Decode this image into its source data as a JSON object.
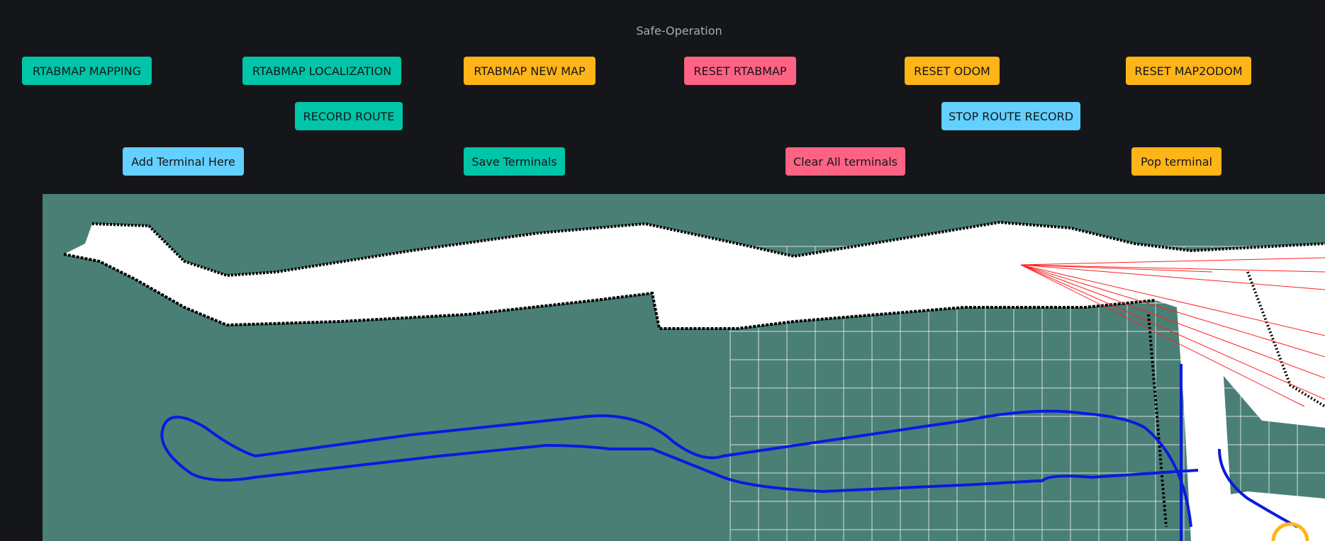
{
  "app": {
    "title": "Safe-Operation"
  },
  "controls": {
    "row1": {
      "mapping": "RTABMAP MAPPING",
      "localization": "RTABMAP LOCALIZATION",
      "new_map": "RTABMAP NEW MAP",
      "reset_rtabmap": "RESET RTABMAP",
      "reset_odom": "RESET ODOM",
      "reset_map2odom": "RESET MAP2ODOM"
    },
    "row2": {
      "record_route": "RECORD ROUTE",
      "stop_route_record": "STOP ROUTE RECORD"
    },
    "row3": {
      "add_terminal": "Add Terminal Here",
      "save_terminals": "Save Terminals",
      "clear_terminals": "Clear All terminals",
      "pop_terminal": "Pop terminal"
    }
  },
  "colors": {
    "background": "#15161a",
    "map_background": "#4a7f76",
    "teal": "#00c5a8",
    "orange": "#ffb418",
    "pink": "#ff6384",
    "blue": "#63d0ff",
    "route": "#0a1ae0",
    "laser": "#ff2020",
    "robot_marker": "#ffb418"
  }
}
